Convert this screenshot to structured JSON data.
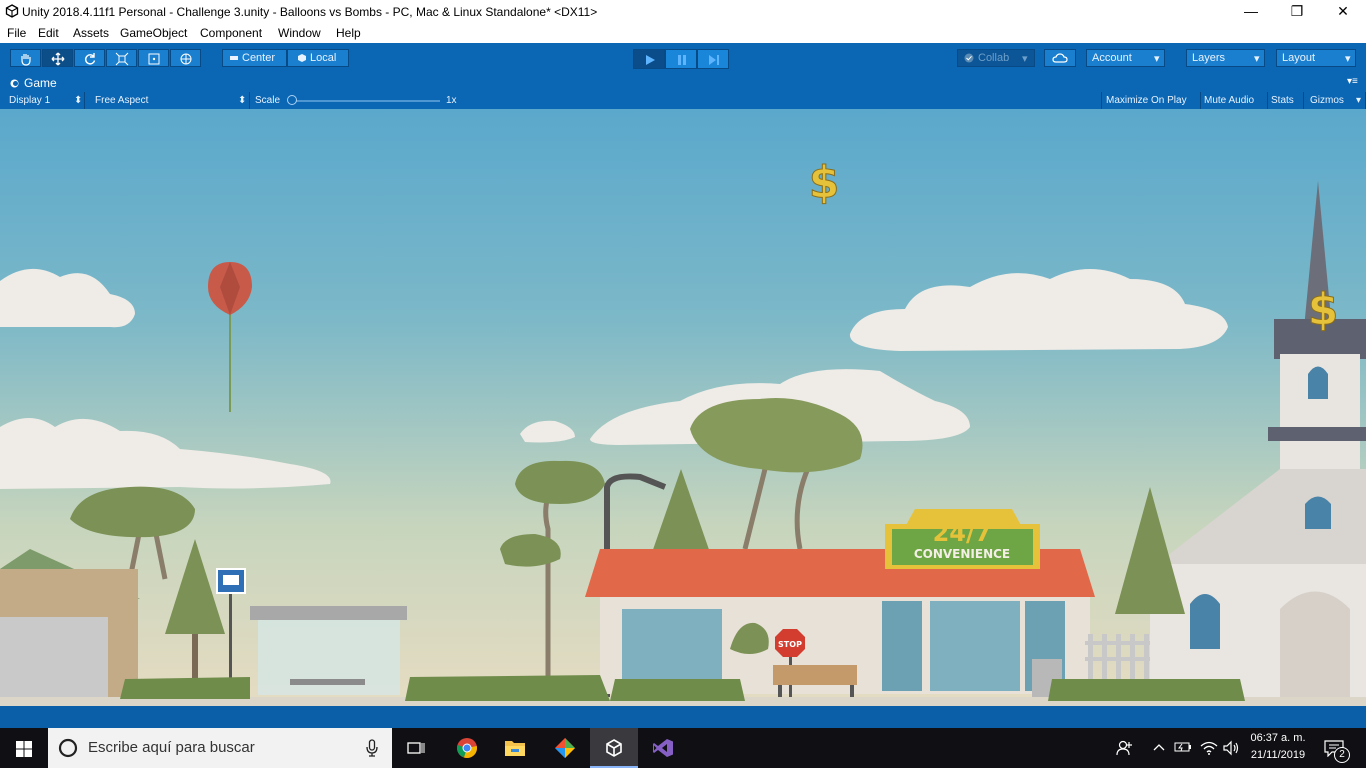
{
  "window": {
    "title": "Unity 2018.4.11f1 Personal - Challenge 3.unity - Balloons vs Bombs - PC, Mac & Linux Standalone* <DX11>",
    "minimize": "—",
    "maximize": "❐",
    "close": "✕"
  },
  "menu": [
    "File",
    "Edit",
    "Assets",
    "GameObject",
    "Component",
    "Window",
    "Help"
  ],
  "toolbar": {
    "pivot_center": "Center",
    "pivot_local": "Local",
    "collab": "Collab",
    "account": "Account",
    "layers": "Layers",
    "layout": "Layout"
  },
  "game_panel": {
    "tab": "Game",
    "display": "Display 1",
    "aspect": "Free Aspect",
    "scale_label": "Scale",
    "scale_value": "1x",
    "maximize_on_play": "Maximize On Play",
    "mute_audio": "Mute Audio",
    "stats": "Stats",
    "gizmos": "Gizmos"
  },
  "scene": {
    "store_sign_big": "24/7",
    "store_sign_small": "CONVENIENCE",
    "stop_sign": "STOP",
    "money_symbol": "$"
  },
  "taskbar": {
    "search_placeholder": "Escribe aquí para buscar",
    "time": "06:37 a. m.",
    "date": "21/11/2019",
    "notifications": "2"
  },
  "colors": {
    "unity_blue": "#0b66b3",
    "balloon": "#c85a4a",
    "money": "#e6c23a",
    "roof": "#e2684a"
  }
}
